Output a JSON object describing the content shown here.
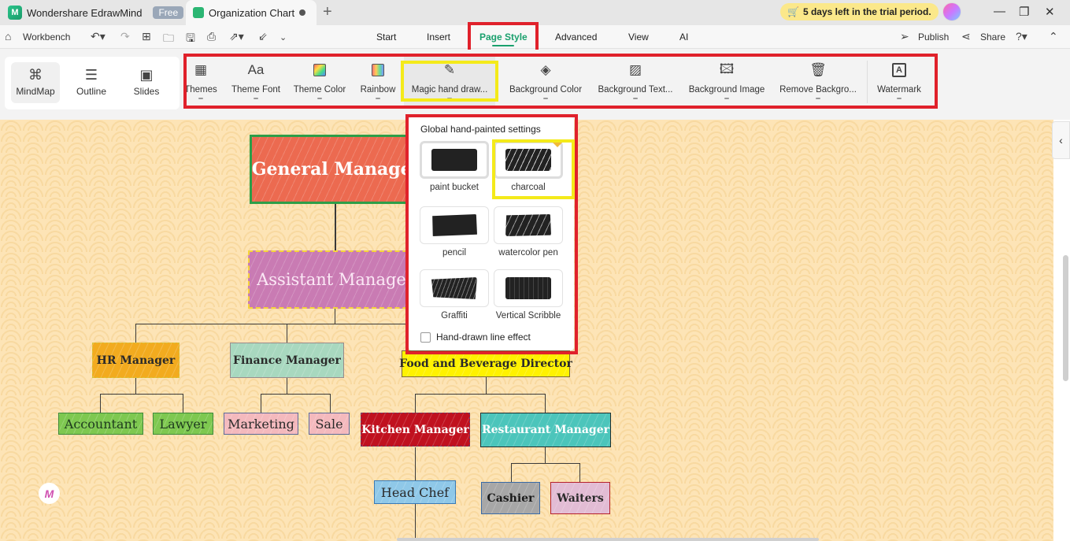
{
  "titlebar": {
    "app_name": "Wondershare EdrawMind",
    "plan_badge": "Free",
    "document_tab": "Organization Chart",
    "new_tab_icon": "+",
    "trial_notice": "5 days left in the trial period.",
    "window_controls": {
      "minimize": "—",
      "maximize": "❐",
      "close": "✕"
    }
  },
  "menubar": {
    "workbench": "Workbench",
    "tabs": [
      {
        "label": "Start"
      },
      {
        "label": "Insert"
      },
      {
        "label": "Page Style",
        "active": true
      },
      {
        "label": "Advanced"
      },
      {
        "label": "View"
      },
      {
        "label": "AI"
      }
    ],
    "publish": "Publish",
    "share": "Share"
  },
  "ribbon": {
    "views": [
      {
        "label": "MindMap",
        "active": true
      },
      {
        "label": "Outline"
      },
      {
        "label": "Slides"
      }
    ],
    "tools": [
      {
        "label": "Themes"
      },
      {
        "label": "Theme Font"
      },
      {
        "label": "Theme Color"
      },
      {
        "label": "Rainbow"
      },
      {
        "label": "Magic hand draw...",
        "active": true
      },
      {
        "label": "Background Color"
      },
      {
        "label": "Background Text..."
      },
      {
        "label": "Background Image"
      },
      {
        "label": "Remove Backgro..."
      },
      {
        "label": "Watermark"
      }
    ]
  },
  "popup": {
    "title": "Global hand-painted settings",
    "brushes": [
      {
        "label": "paint bucket"
      },
      {
        "label": "charcoal",
        "selected": true
      },
      {
        "label": "pencil"
      },
      {
        "label": "watercolor pen"
      },
      {
        "label": "Graffiti"
      },
      {
        "label": "Vertical Scribble"
      }
    ],
    "line_effect_label": "Hand-drawn line effect",
    "line_effect_checked": false
  },
  "org_chart": {
    "nodes": {
      "general_manager": "General Manager",
      "assistant_manager": "Assistant Manager",
      "hr_manager": "HR Manager",
      "finance_manager": "Finance Manager",
      "fb_director": "Food and Beverage Director",
      "accountant": "Accountant",
      "lawyer": "Lawyer",
      "marketing": "Marketing",
      "sale": "Sale",
      "kitchen_manager": "Kitchen Manager",
      "restaurant_manager": "Restaurant Manager",
      "head_chef": "Head Chef",
      "cashier": "Cashier",
      "waiters": "Waiters"
    },
    "colors": {
      "general_manager": "#ec6a50",
      "assistant_manager": "#c97bb3",
      "hr_manager": "#f2ab1f",
      "finance_manager": "#a8d8bf",
      "fb_director": "#fff200",
      "leaf_green": "#7ec850",
      "leaf_pink": "#f4b9bd",
      "kitchen_manager": "#c0111f",
      "restaurant_manager": "#4cc5bb",
      "head_chef": "#8fc8e8",
      "cashier": "#a7a7a7",
      "waiters": "#e2bcd4",
      "canvas_bg": "#fde4b6"
    }
  },
  "accent_color": "#1aa06d"
}
